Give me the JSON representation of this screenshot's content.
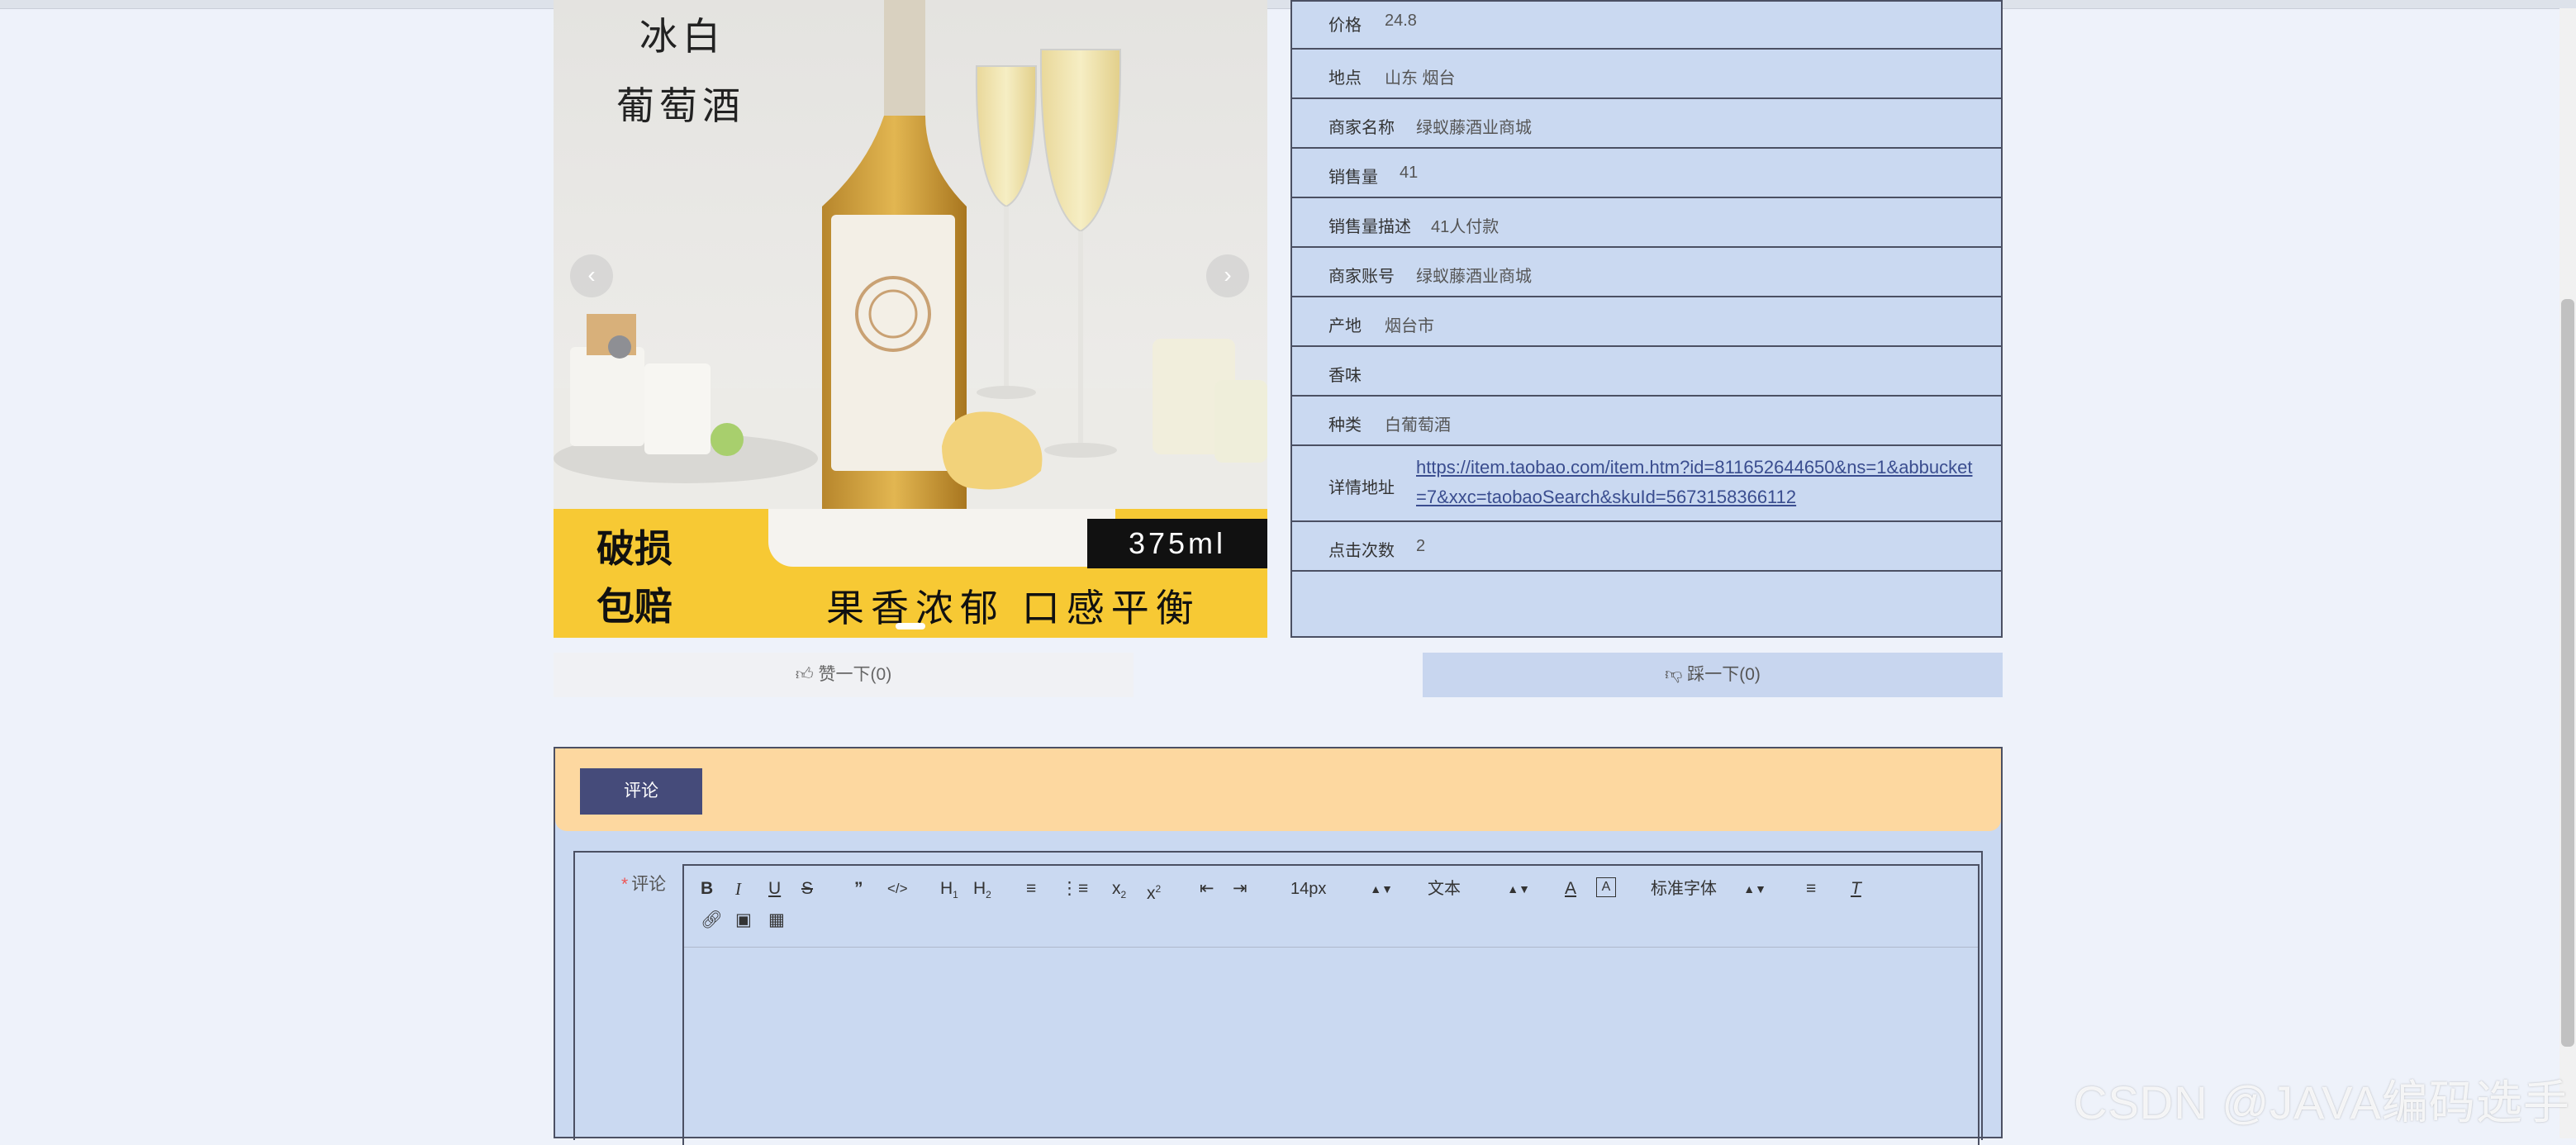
{
  "carousel": {
    "promo_line1": "冰白",
    "promo_line2": "葡萄酒",
    "badge_line1": "破损",
    "badge_line2": "包赔",
    "volume": "375ml",
    "slogan": "果香浓郁 口感平衡",
    "prev_glyph": "‹",
    "next_glyph": "›"
  },
  "info": {
    "rows": [
      {
        "label": "价格",
        "value": "24.8"
      },
      {
        "label": "地点",
        "value": "山东 烟台"
      },
      {
        "label": "商家名称",
        "value": "绿蚁藤酒业商城"
      },
      {
        "label": "销售量",
        "value": "41"
      },
      {
        "label": "销售量描述",
        "value": "41人付款"
      },
      {
        "label": "商家账号",
        "value": "绿蚁藤酒业商城"
      },
      {
        "label": "产地",
        "value": "烟台市"
      },
      {
        "label": "香味",
        "value": ""
      },
      {
        "label": "种类",
        "value": "白葡萄酒"
      }
    ],
    "detail_label": "详情地址",
    "detail_url": "https://item.taobao.com/item.htm?id=811652644650&ns=1&abbucket=7&xxc=taobaoSearch&skuId=5673158366112",
    "clicks_label": "点击次数",
    "clicks_value": "2"
  },
  "vote": {
    "like_label": "赞一下(0)",
    "dislike_label": "踩一下(0)"
  },
  "comment": {
    "tab_label": "评论",
    "field_required": "*",
    "field_label": "评论",
    "toolbar": {
      "font_size": "14px",
      "block_format": "文本",
      "font_family": "标准字体"
    }
  },
  "watermark": "CSDN @JAVA编码选手"
}
